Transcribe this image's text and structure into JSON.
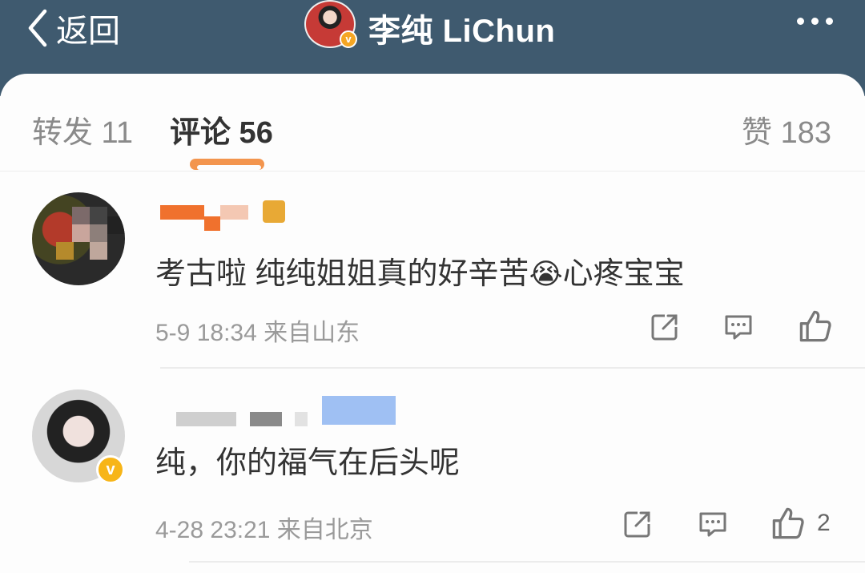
{
  "header": {
    "back_label": "返回",
    "title": "李纯 LiChun",
    "verified_badge": "v"
  },
  "tabs": [
    {
      "label": "转发 11",
      "active": false
    },
    {
      "label": "评论 56",
      "active": true
    },
    {
      "label": "赞 183",
      "active": false
    }
  ],
  "comments": [
    {
      "text": "考古啦 纯纯姐姐真的好辛苦",
      "emoji": "😭",
      "text_after": "心疼宝宝",
      "meta": "5-9 18:34 来自山东",
      "likes": ""
    },
    {
      "text": "纯，你的福气在后头呢",
      "verified_badge": "v",
      "meta": "4-28 23:21 来自北京",
      "likes": "2"
    }
  ],
  "icons": [
    "chevron-left-icon",
    "more-icon",
    "share-icon",
    "comment-icon",
    "like-icon"
  ],
  "colors": {
    "header_bg": "#3f5a6f",
    "accent": "#f28a3b",
    "verified": "#f7b518",
    "text": "#333333",
    "meta": "#9a9a9a"
  }
}
